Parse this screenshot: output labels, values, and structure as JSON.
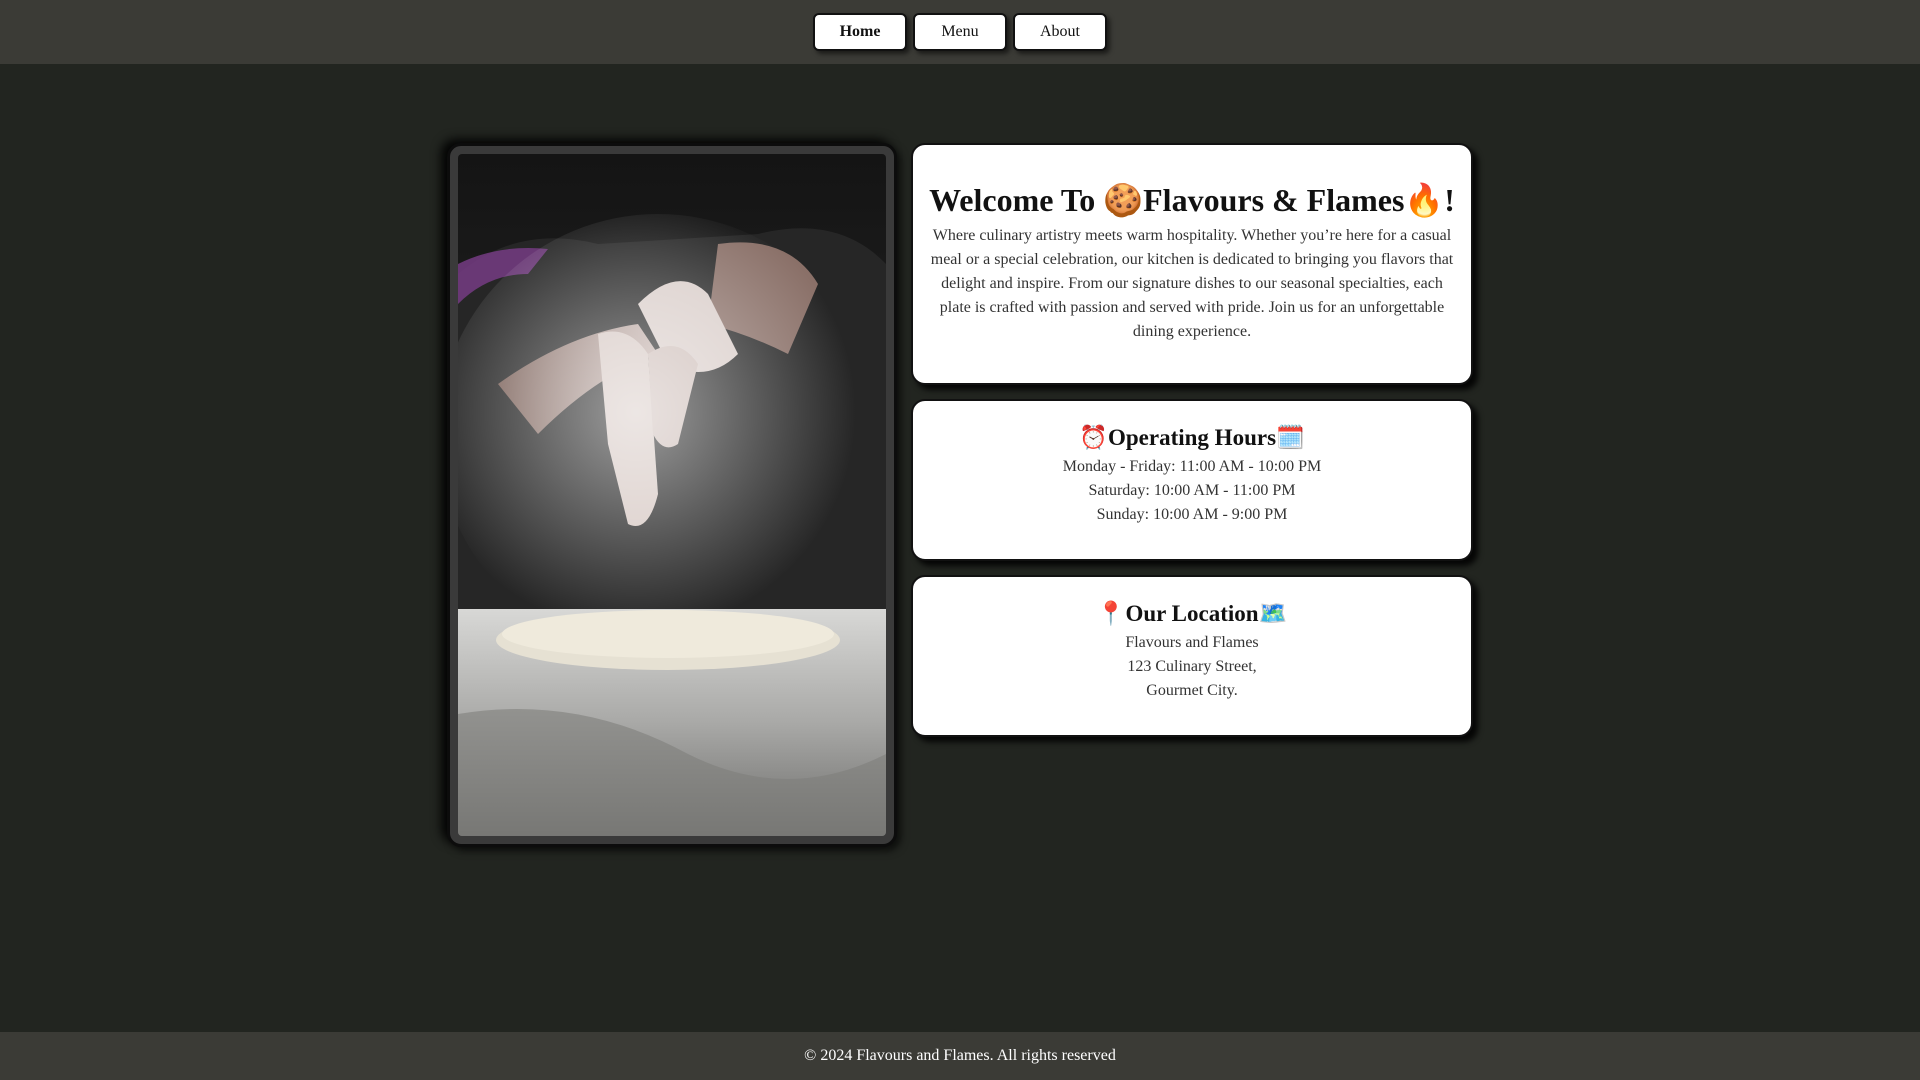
{
  "nav": {
    "items": [
      {
        "label": "Home",
        "active": true
      },
      {
        "label": "Menu",
        "active": false
      },
      {
        "label": "About",
        "active": false
      }
    ]
  },
  "hero_image": {
    "description_icon": "pizza-dough-flour-photo"
  },
  "welcome": {
    "title_prefix": "Welcome To ",
    "title_emoji_1": "🍪",
    "title_name": "Flavours & Flames",
    "title_emoji_2": "🔥",
    "title_suffix": "!",
    "body": "Where culinary artistry meets warm hospitality. Whether you’re here for a casual meal or a special celebration, our kitchen is dedicated to bringing you flavors that delight and inspire. From our signature dishes to our seasonal specialties, each plate is crafted with passion and served with pride. Join us for an unforgettable dining experience."
  },
  "hours": {
    "emoji_before": "⏰",
    "title": "Operating Hours",
    "emoji_after": "🗓️",
    "lines": [
      "Monday - Friday: 11:00 AM - 10:00 PM",
      "Saturday: 10:00 AM - 11:00 PM",
      "Sunday: 10:00 AM - 9:00 PM"
    ]
  },
  "location": {
    "emoji_before": "📍",
    "title": "Our Location",
    "emoji_after": "🗺️",
    "lines": [
      "Flavours and Flames",
      "123 Culinary Street,",
      "Gourmet City."
    ]
  },
  "footer": {
    "text": "© 2024 Flavours and Flames. All rights reserved"
  },
  "colors": {
    "page_bg": "#222520",
    "bar_bg": "#3b3b36",
    "card_bg": "#ffffff"
  }
}
